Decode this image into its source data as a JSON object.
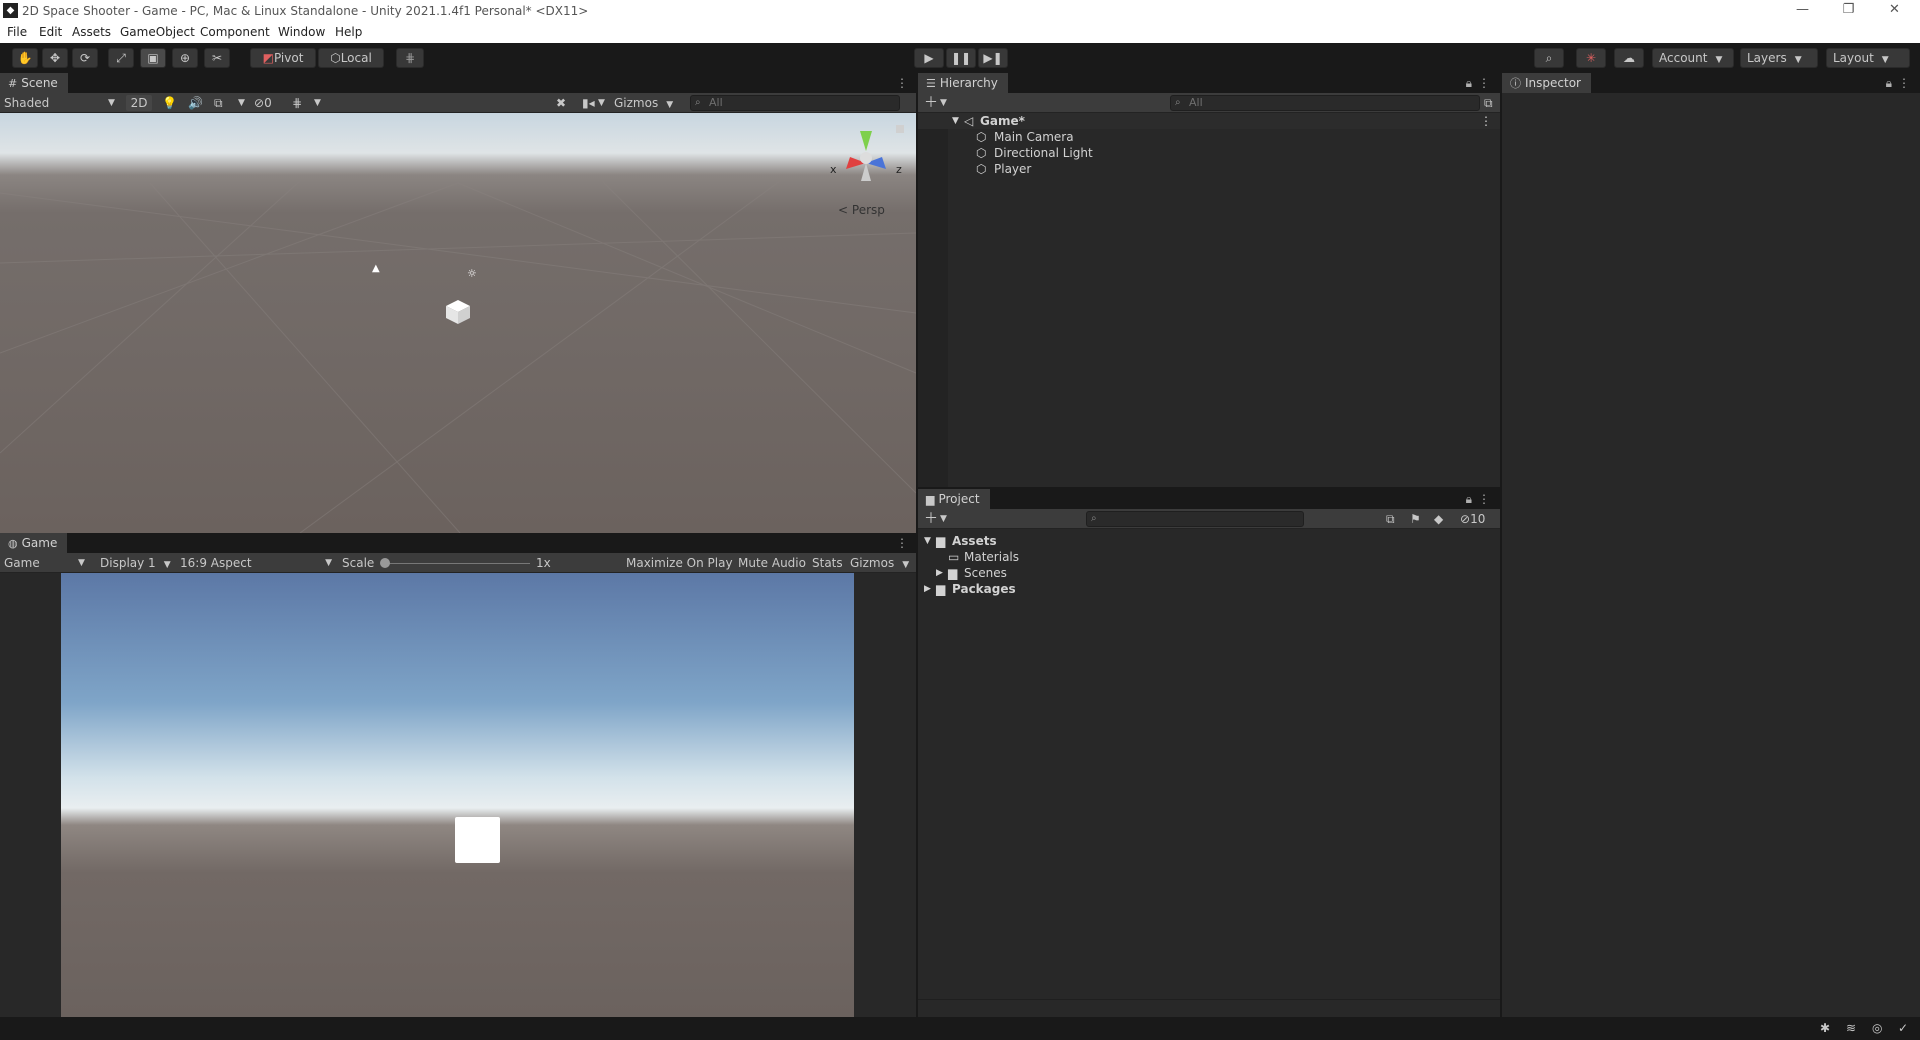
{
  "window": {
    "title": "2D Space Shooter - Game - PC, Mac & Linux Standalone - Unity 2021.1.4f1 Personal* <DX11>",
    "minimize": "—",
    "restore": "❐",
    "close": "✕"
  },
  "menu": [
    "File",
    "Edit",
    "Assets",
    "GameObject",
    "Component",
    "Window",
    "Help"
  ],
  "toolbar": {
    "pivot_label": "Pivot",
    "local_label": "Local",
    "account_label": "Account",
    "layers_label": "Layers",
    "layout_label": "Layout"
  },
  "scene": {
    "tab": "Scene",
    "shading": "Shaded",
    "mode_2d": "2D",
    "hidden_count": "0",
    "gizmos": "Gizmos",
    "search_placeholder": "All",
    "persp_label": "Persp",
    "axis_x": "x",
    "axis_z": "z"
  },
  "game": {
    "tab": "Game",
    "view": "Game",
    "display": "Display 1",
    "aspect": "16:9 Aspect",
    "scale_label": "Scale",
    "scale_value": "1x",
    "maximize": "Maximize On Play",
    "mute": "Mute Audio",
    "stats": "Stats",
    "gizmos": "Gizmos"
  },
  "hierarchy": {
    "tab": "Hierarchy",
    "search_placeholder": "All",
    "scene_name": "Game*",
    "items": [
      "Main Camera",
      "Directional Light",
      "Player"
    ]
  },
  "project": {
    "tab": "Project",
    "hidden_count": "10",
    "tree": [
      {
        "label": "Assets",
        "bold": true
      },
      {
        "label": "Materials",
        "bold": false
      },
      {
        "label": "Scenes",
        "bold": false
      },
      {
        "label": "Packages",
        "bold": true
      }
    ]
  },
  "inspector": {
    "tab": "Inspector"
  },
  "colors": {
    "editor_bg": "#282828",
    "toolbar_bg": "#191919",
    "tab_bg": "#3c3c3c"
  }
}
